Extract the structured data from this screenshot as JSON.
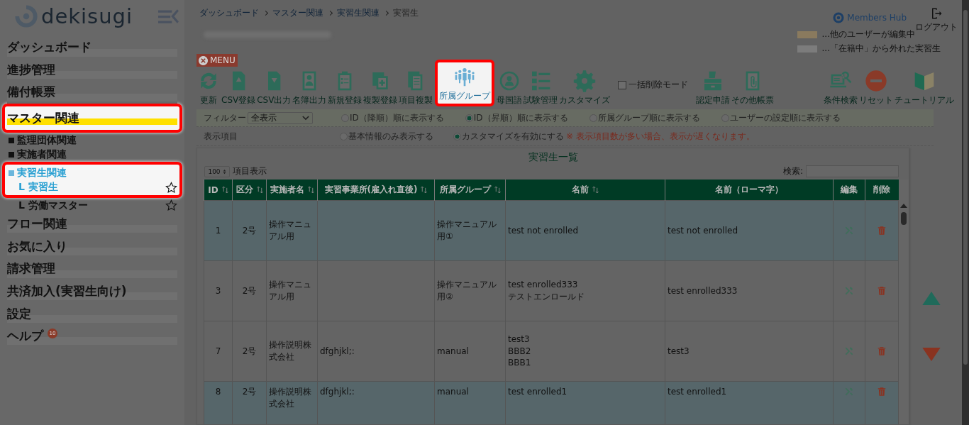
{
  "header": {
    "logo": "dekisugi",
    "breadcrumb": [
      "ダッシュボード",
      "マスター関連",
      "実習生関連",
      "実習生"
    ],
    "brand": "Members Hub",
    "logout": "ログアウト"
  },
  "sidebar": [
    {
      "label": "ダッシュボード",
      "highlighted": false,
      "selected": false
    },
    {
      "label": "進捗管理",
      "highlighted": false,
      "selected": false
    },
    {
      "label": "備付帳票",
      "highlighted": false,
      "selected": false
    },
    {
      "label": "マスター関連",
      "highlighted": true,
      "selected": true,
      "children": [
        {
          "label": "監理団体関連",
          "highlighted": false,
          "selected": false
        },
        {
          "label": "実施者関連",
          "highlighted": false,
          "selected": false
        },
        {
          "label": "実習生関連",
          "highlighted": true,
          "selected": true,
          "children": [
            {
              "label": "L 実習生",
              "highlighted": true,
              "selected": true
            },
            {
              "label": "L 労働マスター",
              "highlighted": false,
              "selected": false
            }
          ]
        }
      ]
    },
    {
      "label": "フロー関連",
      "highlighted": false,
      "selected": false
    },
    {
      "label": "お気に入り",
      "highlighted": false,
      "selected": false
    },
    {
      "label": "請求管理",
      "highlighted": false,
      "selected": false
    },
    {
      "label": "共済加入(実習生向け)",
      "highlighted": false,
      "selected": false
    },
    {
      "label": "設定",
      "highlighted": false,
      "selected": false
    },
    {
      "label": "ヘルプ",
      "highlighted": false,
      "selected": false,
      "badge": "10"
    }
  ],
  "menu_button": "MENU",
  "tools": [
    {
      "label": "更新",
      "highlighted": false
    },
    {
      "label": "CSV登録",
      "highlighted": false
    },
    {
      "label": "CSV出力",
      "highlighted": false
    },
    {
      "label": "名簿出力",
      "highlighted": false
    },
    {
      "label": "新規登録",
      "highlighted": false
    },
    {
      "label": "複製登録",
      "highlighted": false
    },
    {
      "label": "項目複製",
      "highlighted": false
    },
    {
      "label": "所属グループ",
      "highlighted": true
    },
    {
      "label": "母国語",
      "highlighted": false
    },
    {
      "label": "試験管理",
      "highlighted": false
    },
    {
      "label": "カスタマイズ",
      "highlighted": false
    }
  ],
  "bulk_delete": {
    "label": "一括削除モード",
    "checked": false
  },
  "reports": [
    {
      "label": "認定申請"
    },
    {
      "label": "その他帳票"
    }
  ],
  "legend": [
    {
      "color": "#8a7a5e",
      "label": "...他のユーザーが編集中"
    },
    {
      "color": "#7c7c7c",
      "label": "...「在籍中」から外れた実習生"
    }
  ],
  "actions": [
    {
      "label": "条件検索"
    },
    {
      "label": "リセット"
    },
    {
      "label": "チュートリアル"
    }
  ],
  "filter": {
    "label": "フィルター",
    "value": "全表示",
    "options": [
      {
        "label": "ID（降順）順に表示する",
        "selected": false
      },
      {
        "label": "ID（昇順）順に表示する",
        "selected": true
      },
      {
        "label": "所属グループ順に表示する",
        "selected": false
      },
      {
        "label": "ユーザーの設定順に表示する",
        "selected": false
      }
    ]
  },
  "display": {
    "label": "表示項目",
    "options": [
      {
        "label": "基本情報のみ表示する",
        "selected": false
      },
      {
        "label": "カスタマイズを有効にする",
        "selected": true
      }
    ],
    "note": "※ 表示項目数が多い場合、表示が遅くなります。"
  },
  "table": {
    "title": "実習生一覧",
    "page_size": "100",
    "page_size_label": "項目表示",
    "search_label": "検索:",
    "columns": [
      {
        "label": "ID",
        "sortable": true
      },
      {
        "label": "区分",
        "sortable": true
      },
      {
        "label": "実施者名",
        "sortable": true
      },
      {
        "label": "実習事業所(雇入れ直後)",
        "sortable": true
      },
      {
        "label": "所属グループ",
        "sortable": true
      },
      {
        "label": "名前",
        "sortable": true
      },
      {
        "label": "名前（ローマ字）",
        "sortable": false
      },
      {
        "label": "編集",
        "sortable": false
      },
      {
        "label": "削除",
        "sortable": false
      }
    ],
    "rows": [
      {
        "shaded": true,
        "cells": [
          "1",
          "2号",
          "操作マニュアル用",
          "",
          "操作マニュアル用①",
          "test not enrolled",
          "test not enrolled"
        ]
      },
      {
        "shaded": false,
        "cells": [
          "3",
          "2号",
          "操作マニュアル用",
          "",
          "操作マニュアル用②",
          "test enrolled333\nテストエンロールド",
          "test enrolled333"
        ]
      },
      {
        "shaded": false,
        "cells": [
          "7",
          "2号",
          "操作説明株式会社",
          "dfghjkl;:",
          "manual",
          "test3\nBBB2\nBBB1",
          "test3"
        ]
      },
      {
        "shaded": true,
        "cells": [
          "8",
          "2号",
          "操作説明株式会社",
          "dfghjkl;:",
          "manual",
          "test enrolled1",
          "test enrolled1"
        ]
      }
    ]
  }
}
